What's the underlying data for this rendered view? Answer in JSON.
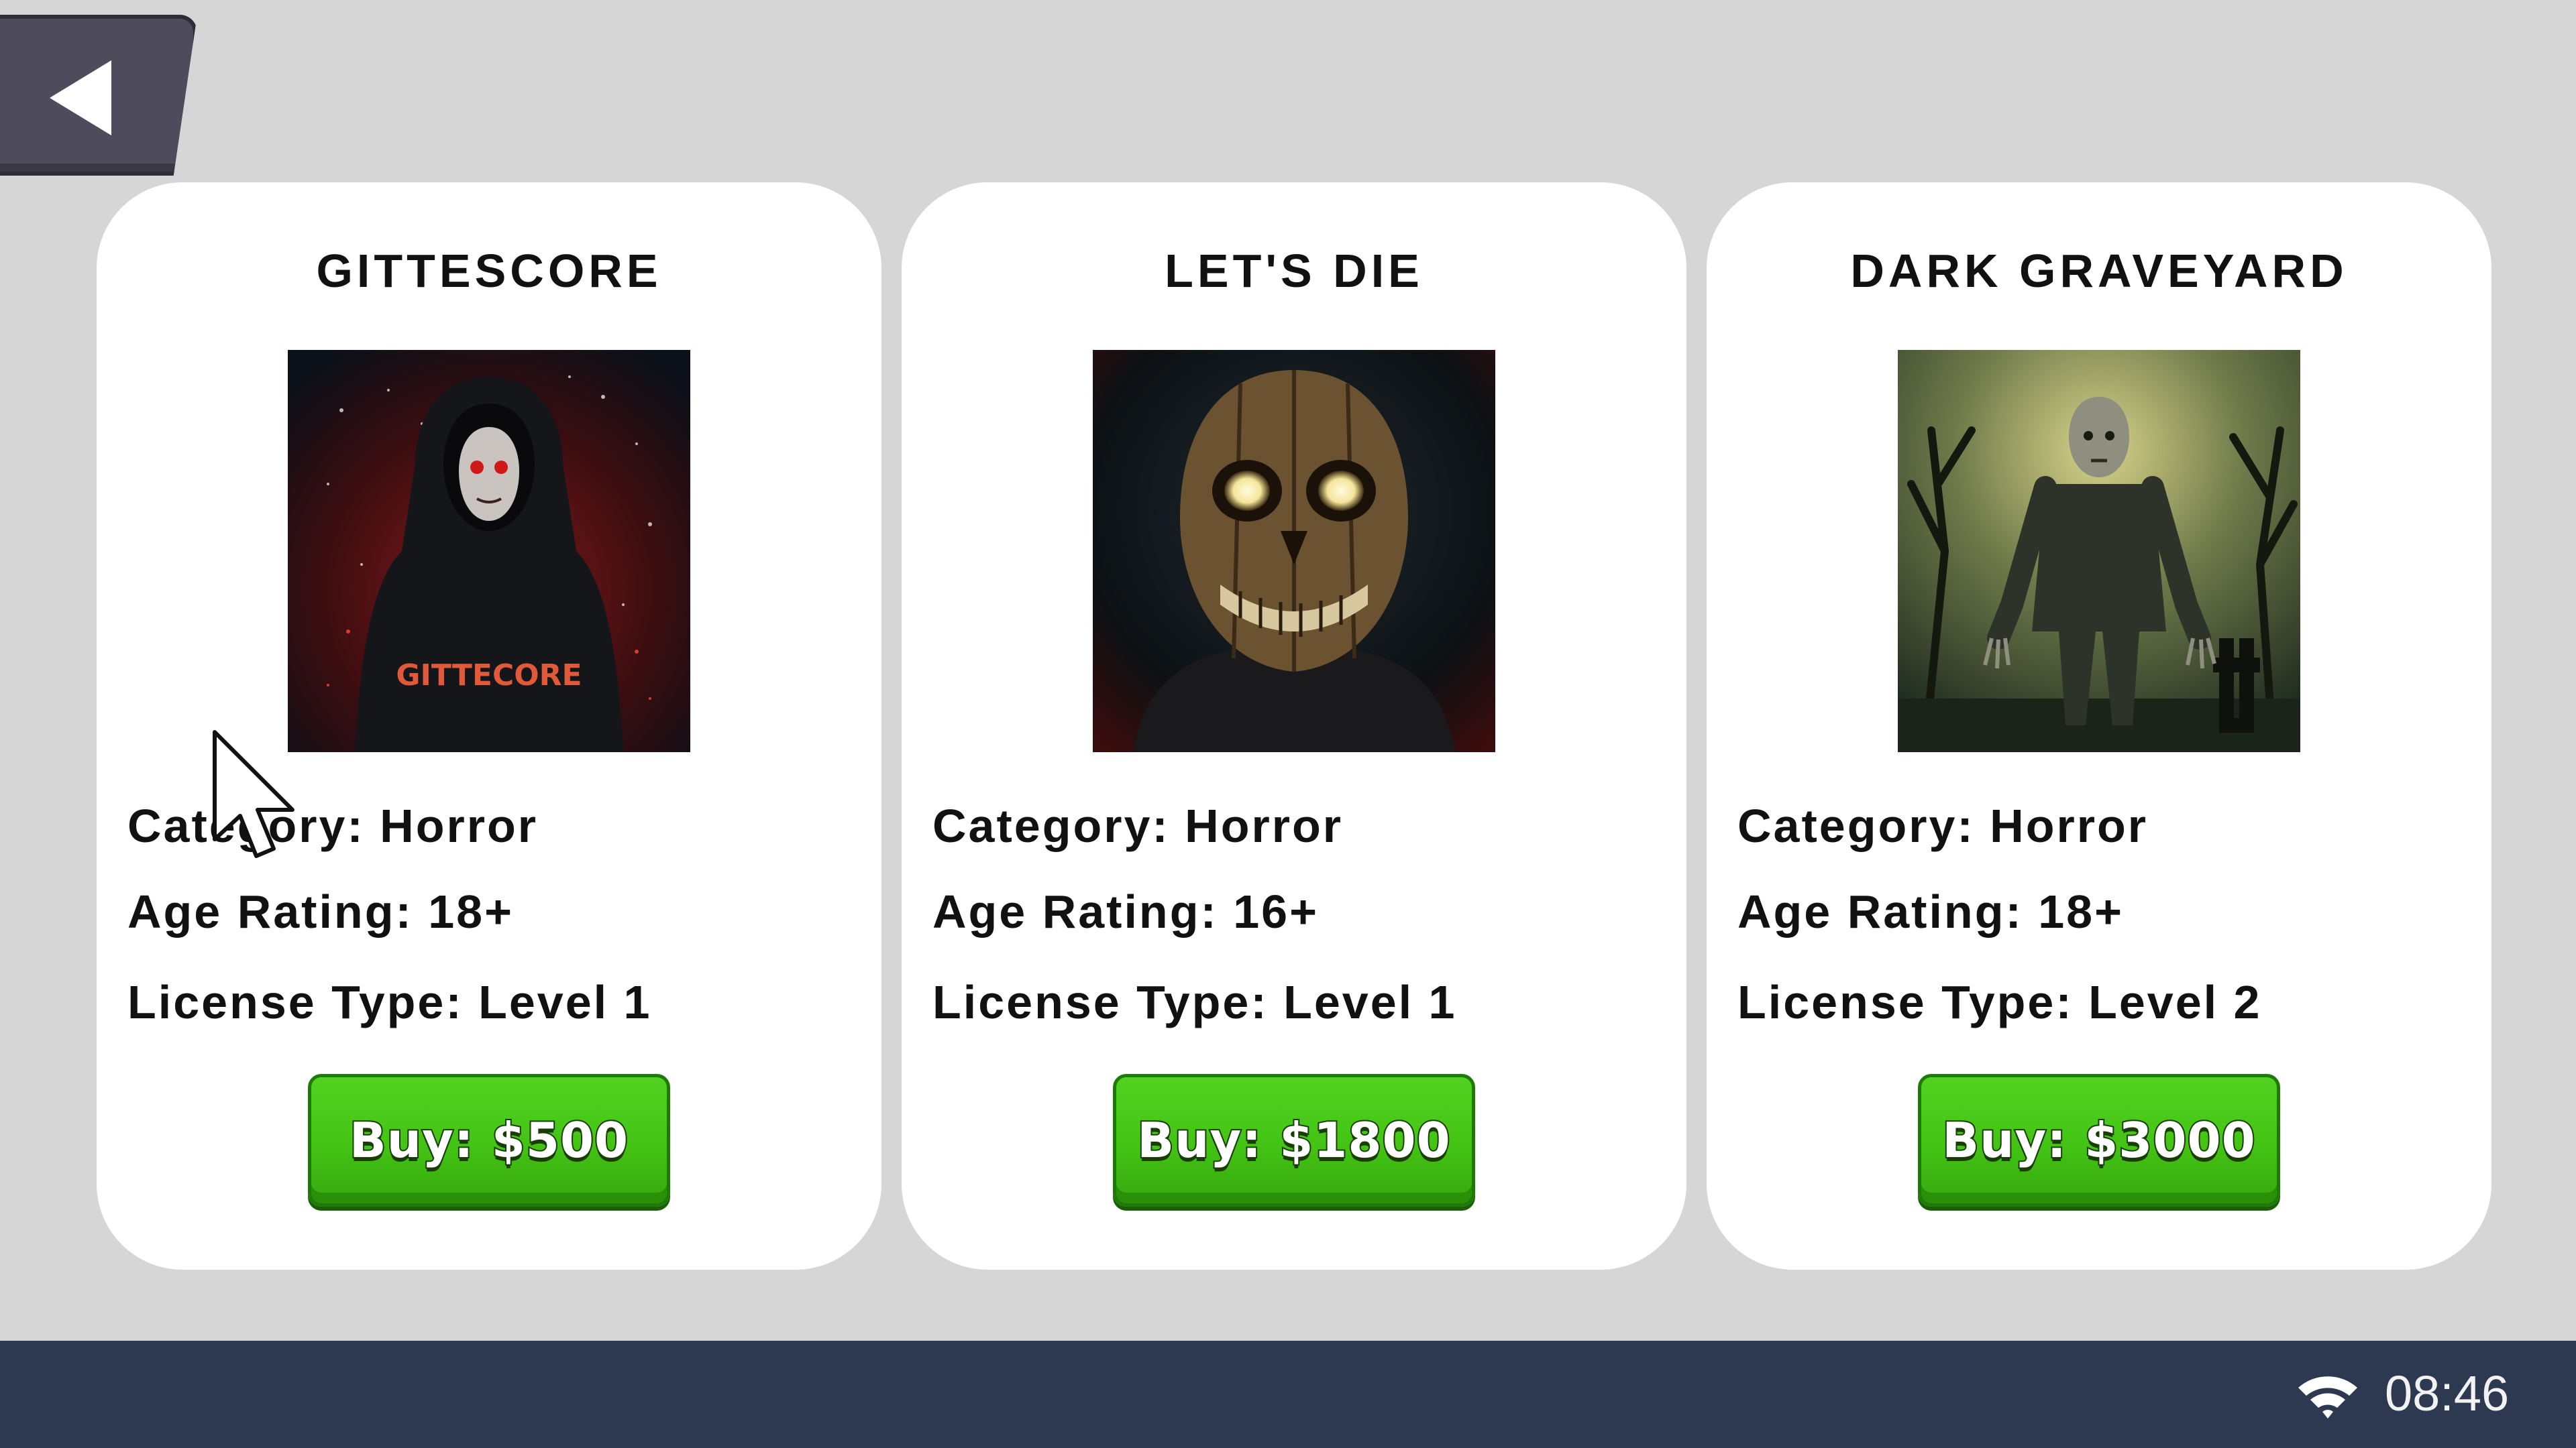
{
  "back_button": {
    "icon": "back-arrow-icon"
  },
  "cards": [
    {
      "title": "GITTESCORE",
      "poster_text": "GITTECORE",
      "category": "Category: Horror",
      "age_rating": "Age Rating: 18+",
      "license": "License Type: Level 1",
      "buy_label": "Buy: $500"
    },
    {
      "title": "LET'S DIE",
      "category": "Category: Horror",
      "age_rating": "Age Rating: 16+",
      "license": "License Type: Level 1",
      "buy_label": "Buy: $1800"
    },
    {
      "title": "DARK GRAVEYARD",
      "category": "Category: Horror",
      "age_rating": "Age Rating: 18+",
      "license": "License Type: Level 2",
      "buy_label": "Buy: $3000"
    }
  ],
  "taskbar": {
    "clock": "08:46",
    "wifi_icon": "wifi-icon"
  },
  "colors": {
    "button_green": "#43c314",
    "taskbar": "#2c3950",
    "background": "#d6d6d6"
  }
}
